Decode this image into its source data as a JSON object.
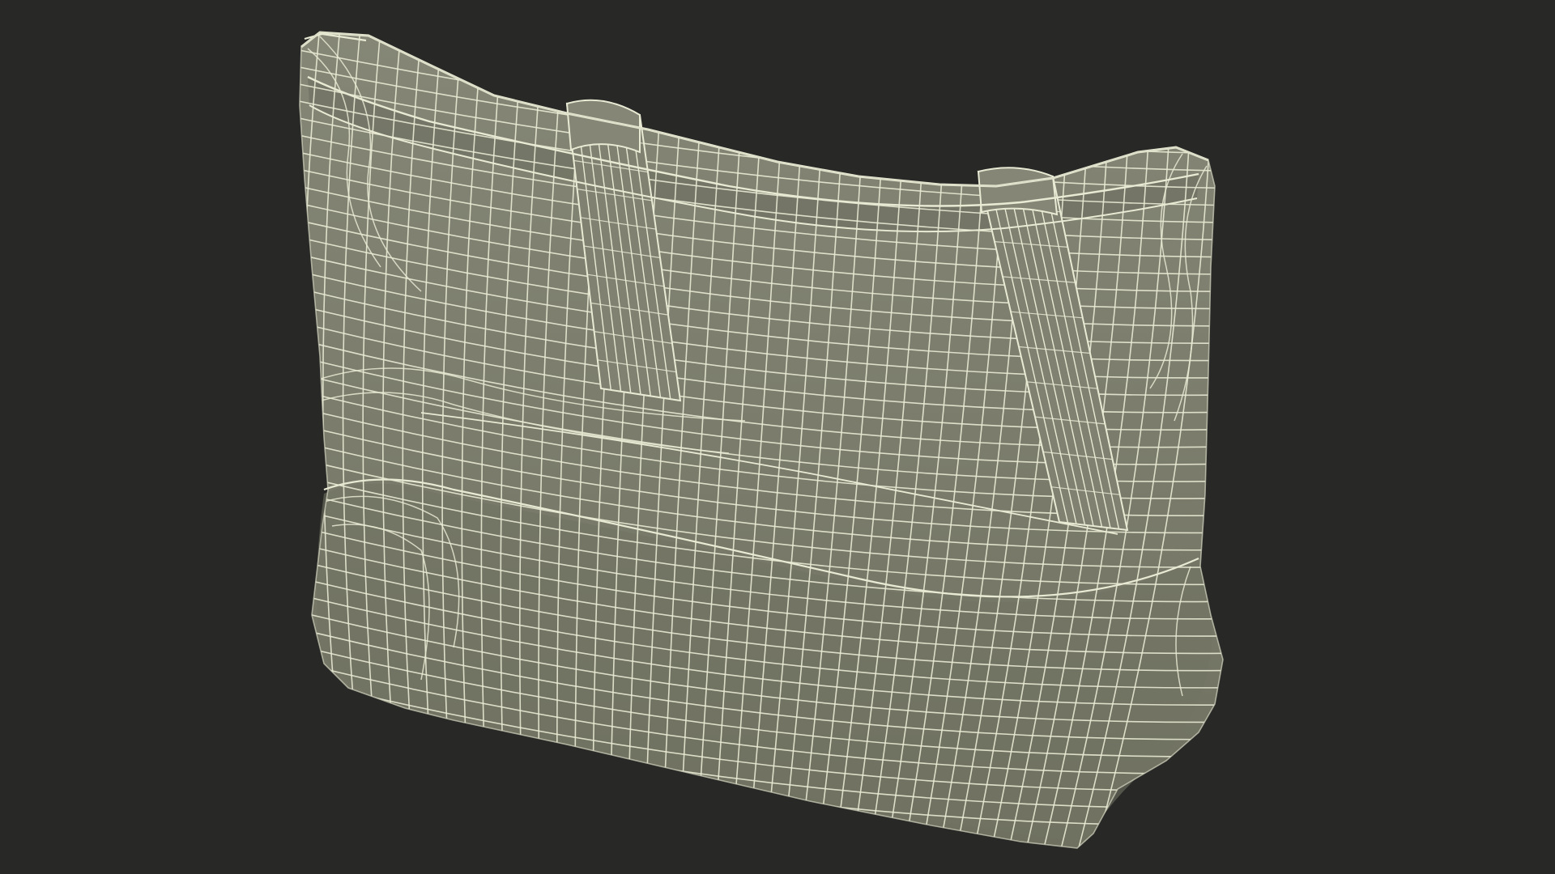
{
  "scene": {
    "background_color": "#282826",
    "mesh_fill_color": "#7b7c6c",
    "mesh_shadow_color": "#6a6b5c",
    "wire_color": "#e9ead4",
    "subject": "tote-bag-wireframe-model"
  }
}
